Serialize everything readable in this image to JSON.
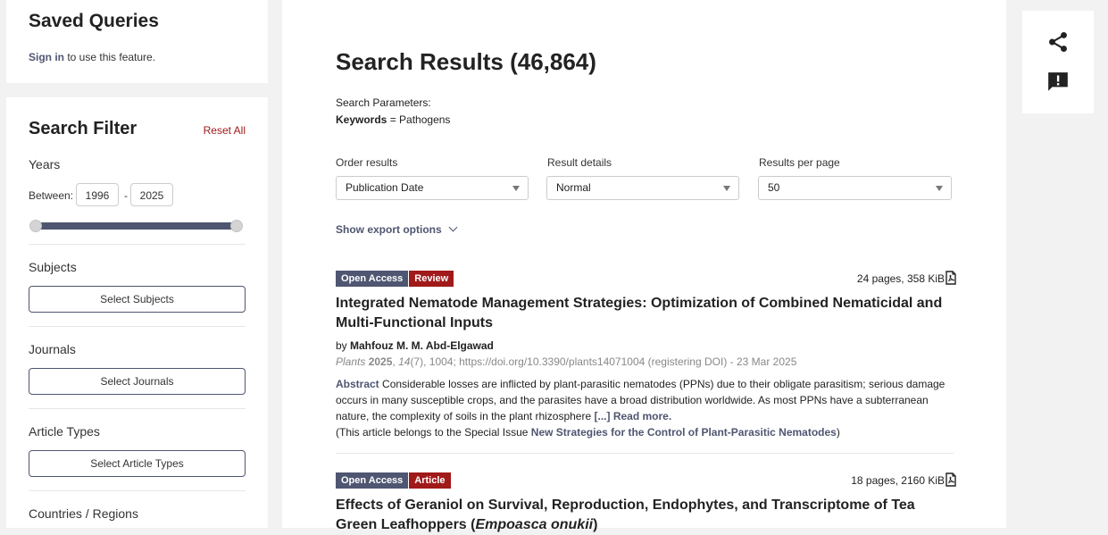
{
  "saved_queries": {
    "title": "Saved Queries",
    "sign_in_link": "Sign in",
    "sign_in_suffix": " to use this feature."
  },
  "filter": {
    "title": "Search Filter",
    "reset_all": "Reset All",
    "years_label": "Years",
    "between_label": "Between:",
    "year_from": "1996",
    "year_separator": "-",
    "year_to": "2025",
    "subjects_label": "Subjects",
    "subjects_button": "Select Subjects",
    "journals_label": "Journals",
    "journals_button": "Select Journals",
    "article_types_label": "Article Types",
    "article_types_button": "Select Article Types",
    "countries_label": "Countries / Regions"
  },
  "results": {
    "heading": "Search Results (46,864)",
    "params_label": "Search Parameters:",
    "params_key": "Keywords",
    "params_value": " = Pathogens",
    "order_label": "Order results",
    "order_value": "Publication Date",
    "details_label": "Result details",
    "details_value": "Normal",
    "perpage_label": "Results per page",
    "perpage_value": "50",
    "export_label": "Show export options"
  },
  "articles": [
    {
      "badge_oa": "Open Access",
      "badge_type": "Review",
      "pages_size": "24 pages, 358 KiB",
      "title": "Integrated Nematode Management Strategies: Optimization of Combined Nematicidal and Multi-Functional Inputs",
      "by": "by ",
      "authors": "Mahfouz M. M. Abd-Elgawad",
      "journal": "Plants",
      "year": "2025",
      "volume": "14",
      "issue_pages": "(7), 1004; https://doi.org/10.3390/plants14071004 (registering DOI) - 23 Mar 2025",
      "abstract_label": "Abstract",
      "abstract_text": " Considerable losses are inflicted by plant-parasitic nematodes (PPNs) due to their obligate parasitism; serious damage occurs in many susceptible crops, and the parasites have a broad distribution worldwide. As most PPNs have a subterranean nature, the complexity of soils in the plant rhizosphere ",
      "read_more": "[...] Read more.",
      "special_issue_prefix": "(This article belongs to the Special Issue ",
      "special_issue_link": "New Strategies for the Control of Plant-Parasitic Nematodes",
      "special_issue_suffix": ")"
    },
    {
      "badge_oa": "Open Access",
      "badge_type": "Article",
      "pages_size": "18 pages, 2160 KiB",
      "title_main": "Effects of Geraniol on Survival, Reproduction, Endophytes, and Transcriptome of Tea Green Leafhoppers (",
      "title_italic": "Empoasca onukii",
      "title_end": ")"
    }
  ],
  "icons": {
    "share": "share-icon",
    "feedback": "feedback-icon",
    "pdf": "pdf-icon",
    "chevron": "chevron-down-icon"
  },
  "colors": {
    "accent": "#4f5671",
    "red": "#a01a1a"
  }
}
